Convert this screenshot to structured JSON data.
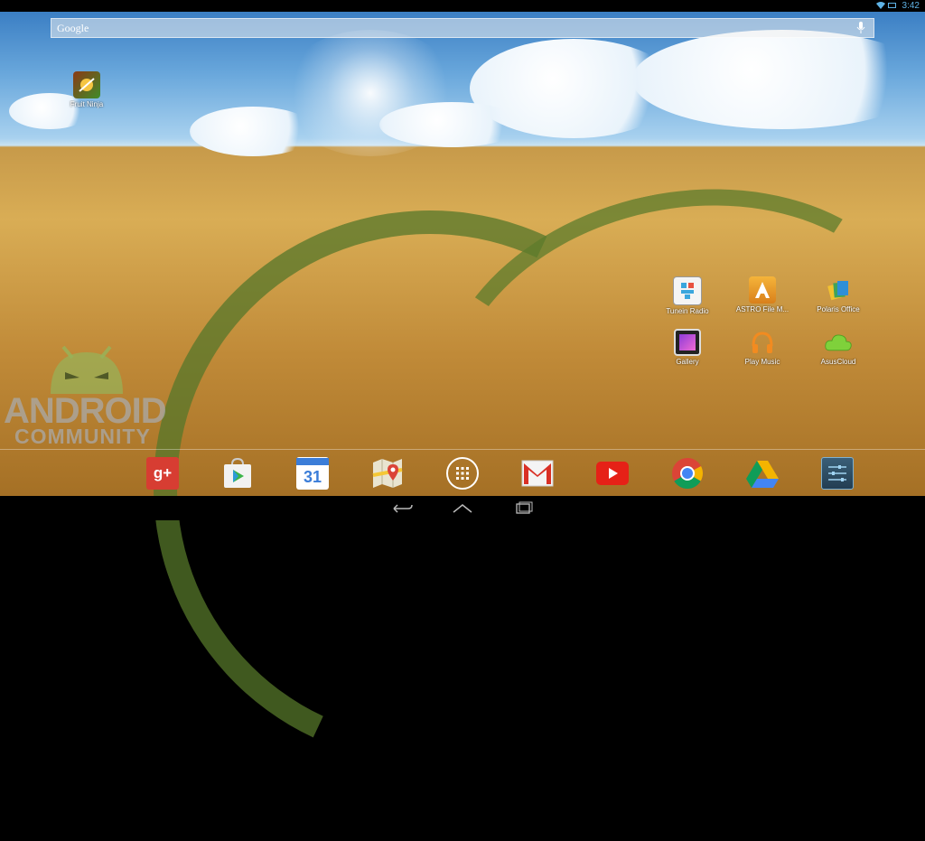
{
  "status_bar": {
    "time": "3:42",
    "icons": [
      "wifi-icon",
      "battery-icon"
    ]
  },
  "search_bar": {
    "label": "Google",
    "icons": [
      "mic-icon"
    ]
  },
  "desktop_top": [
    {
      "label": "Fruit Ninja",
      "icon": "fruit-ninja-icon"
    }
  ],
  "desktop_apps": [
    {
      "label": "Tunein Radio",
      "icon": "tunein-radio-icon"
    },
    {
      "label": "ASTRO File M...",
      "icon": "astro-file-manager-icon"
    },
    {
      "label": "Polaris Office",
      "icon": "polaris-office-icon"
    },
    {
      "label": "Gallery",
      "icon": "gallery-icon"
    },
    {
      "label": "Play Music",
      "icon": "play-music-icon"
    },
    {
      "label": "AsusCloud",
      "icon": "asuscloud-icon"
    }
  ],
  "watermark": {
    "line1": "ANDROID",
    "line2": "COMMUNITY"
  },
  "dock": [
    {
      "name": "google-plus",
      "icon": "google-plus-icon",
      "glyph": "g+"
    },
    {
      "name": "play-store",
      "icon": "play-store-icon",
      "glyph": ""
    },
    {
      "name": "calendar",
      "icon": "calendar-icon",
      "glyph": "31"
    },
    {
      "name": "maps",
      "icon": "maps-icon",
      "glyph": ""
    },
    {
      "name": "all-apps",
      "icon": "all-apps-icon",
      "glyph": ""
    },
    {
      "name": "gmail",
      "icon": "gmail-icon",
      "glyph": "M"
    },
    {
      "name": "youtube",
      "icon": "youtube-icon",
      "glyph": ""
    },
    {
      "name": "chrome",
      "icon": "chrome-icon",
      "glyph": ""
    },
    {
      "name": "drive",
      "icon": "drive-icon",
      "glyph": ""
    },
    {
      "name": "settings",
      "icon": "settings-icon",
      "glyph": ""
    }
  ],
  "nav_bar": {
    "buttons": [
      "back-icon",
      "home-icon",
      "recents-icon"
    ]
  },
  "colors": {
    "status_accent": "#5fb3e6",
    "sky": "#6aa8dc",
    "wheat": "#c99a45"
  }
}
